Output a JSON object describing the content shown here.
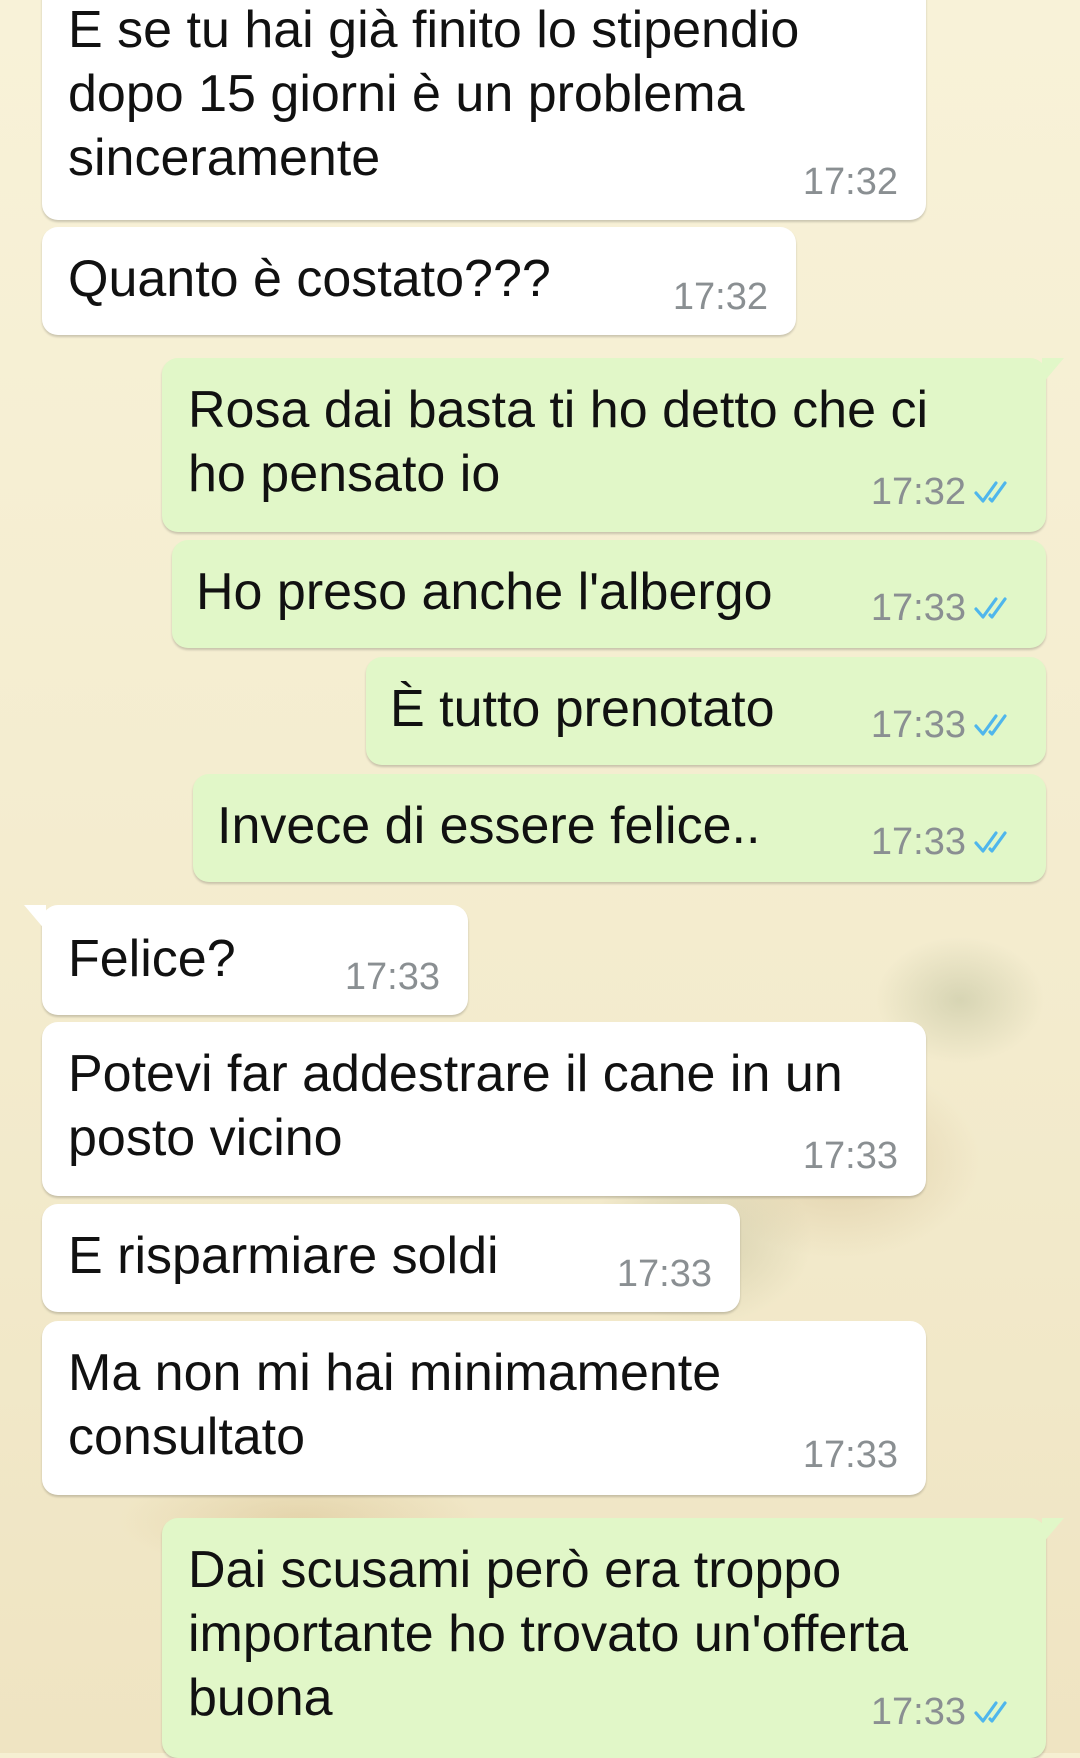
{
  "colors": {
    "incoming_bubble": "#ffffff",
    "outgoing_bubble": "#e1f7c8",
    "timestamp": "#8a8f92",
    "read_ticks": "#4fb6ec"
  },
  "messages": [
    {
      "direction": "in",
      "text": "E se tu hai già finito lo stipendio\ndopo 15 giorni è un problema\nsinceramente",
      "time": "17:32"
    },
    {
      "direction": "in",
      "text": "Quanto è costato???",
      "time": "17:32"
    },
    {
      "direction": "out",
      "text": "Rosa dai basta ti ho detto che ci\nho pensato io",
      "time": "17:32",
      "status_icon": "double-check-read-icon"
    },
    {
      "direction": "out",
      "text": "Ho preso anche l'albergo",
      "time": "17:33",
      "status_icon": "double-check-read-icon"
    },
    {
      "direction": "out",
      "text": "È tutto prenotato",
      "time": "17:33",
      "status_icon": "double-check-read-icon"
    },
    {
      "direction": "out",
      "text": "Invece di essere felice..",
      "time": "17:33",
      "status_icon": "double-check-read-icon"
    },
    {
      "direction": "in",
      "text": "Felice?",
      "time": "17:33"
    },
    {
      "direction": "in",
      "text": "Potevi far addestrare il cane in un\nposto vicino",
      "time": "17:33"
    },
    {
      "direction": "in",
      "text": "E risparmiare soldi",
      "time": "17:33"
    },
    {
      "direction": "in",
      "text": "Ma non mi hai minimamente\nconsultato",
      "time": "17:33"
    },
    {
      "direction": "out",
      "text": "Dai scusami però era troppo\nimportante ho trovato un'offerta\nbuona",
      "time": "17:33",
      "status_icon": "double-check-read-icon"
    }
  ]
}
